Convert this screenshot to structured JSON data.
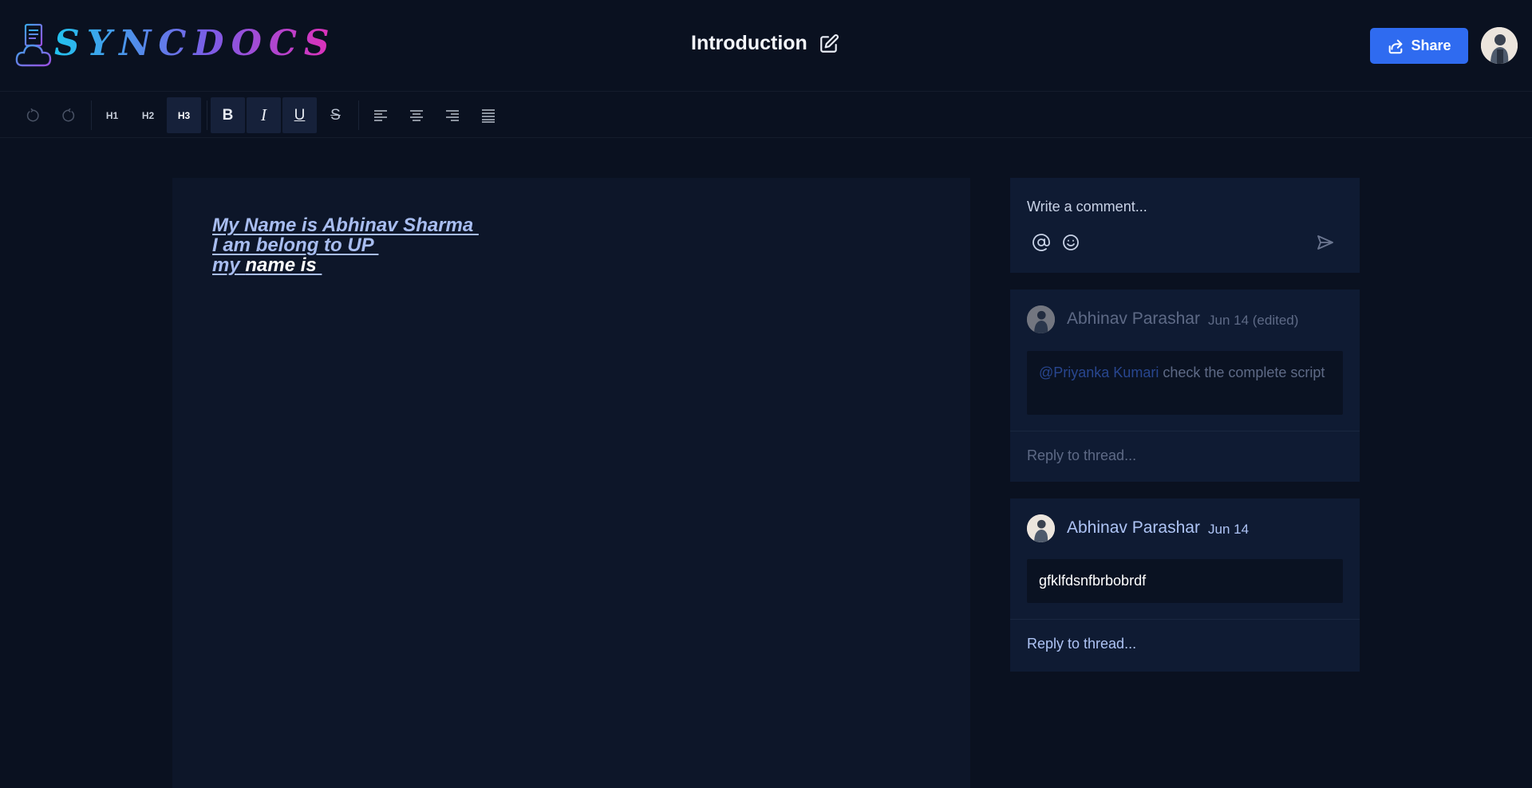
{
  "app": {
    "logo_text": "SYNCDOCS"
  },
  "header": {
    "doc_title": "Introduction",
    "share_label": "Share"
  },
  "toolbar": {
    "undo_icon": "undo-icon",
    "redo_icon": "redo-icon",
    "h1": "H1",
    "h2": "H2",
    "h3": "H3",
    "bold": "B",
    "italic": "I",
    "underline": "U",
    "strike": "S",
    "active_heading": "H3",
    "alignments": [
      "align-left-icon",
      "align-center-icon",
      "align-right-icon",
      "align-justify-icon"
    ]
  },
  "editor": {
    "lines": [
      "My Name is Abhinav Sharma ",
      "I am belong to UP ",
      "my "
    ],
    "highlight": "name is "
  },
  "comment_box": {
    "placeholder": "Write a comment...",
    "mention_icon": "at-icon",
    "emoji_icon": "emoji-icon",
    "send_icon": "send-icon"
  },
  "threads": [
    {
      "author": "Abhinav Parashar",
      "date": "Jun 14 (edited)",
      "mention": "@Priyanka Kumari",
      "text": " check the complete script",
      "reply_placeholder": "Reply to thread...",
      "faded": true
    },
    {
      "author": "Abhinav Parashar",
      "date": "Jun 14",
      "text": "gfklfdsnfbrbobrdf",
      "reply_placeholder": "Reply to thread...",
      "faded": false
    }
  ],
  "colors": {
    "background": "#0a1120",
    "panel": "#0f1b33",
    "editor": "#0d1629",
    "accent": "#2f6bf0",
    "editor_text": "#a8bdf0"
  }
}
